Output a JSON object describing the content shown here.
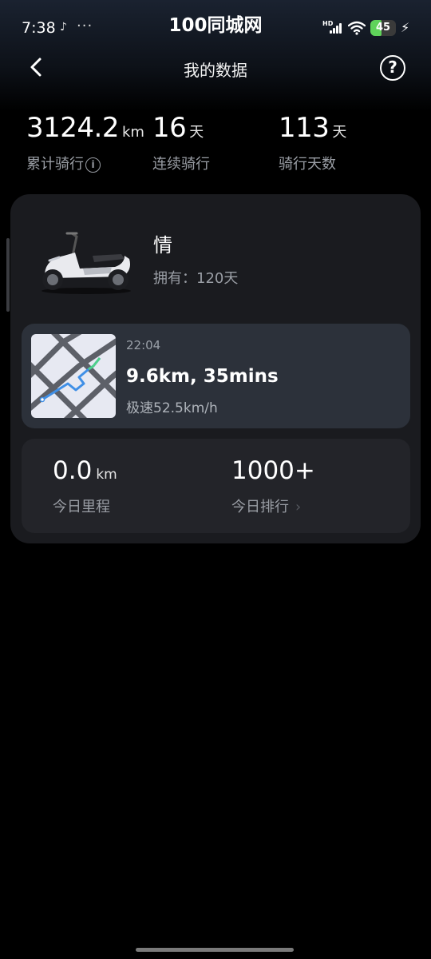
{
  "status_bar": {
    "time": "7:38",
    "tiktok_glyph": "♪",
    "dots": "···",
    "watermark": "100同城网",
    "hd": "HD",
    "battery": "45",
    "bolt": "⚡"
  },
  "nav": {
    "title": "我的数据",
    "help_glyph": "?"
  },
  "stats": [
    {
      "value": "3124.2",
      "unit": "km",
      "label": "累计骑行"
    },
    {
      "value": "16",
      "unit": "天",
      "label": "连续骑行"
    },
    {
      "value": "113",
      "unit": "天",
      "label": "骑行天数"
    }
  ],
  "info_glyph": "i",
  "vehicle": {
    "name": "情",
    "owned": "拥有：120天"
  },
  "trip": {
    "time": "22:04",
    "summary": "9.6km, 35mins",
    "top_speed": "极速52.5km/h"
  },
  "today": {
    "distance_value": "0.0",
    "distance_unit": "km",
    "distance_label": "今日里程",
    "rank_value": "1000+",
    "rank_label": "今日排行",
    "chevron": "›"
  },
  "icons": [
    "back-arrow-icon",
    "help-icon",
    "info-icon",
    "chevron-right-icon",
    "wifi-icon",
    "signal-icon",
    "battery-icon"
  ],
  "colors": {
    "battery": "#5fd35a",
    "card": "#1a1b1f",
    "trip_card": "#2c313a",
    "route": "#3f8fe6"
  }
}
